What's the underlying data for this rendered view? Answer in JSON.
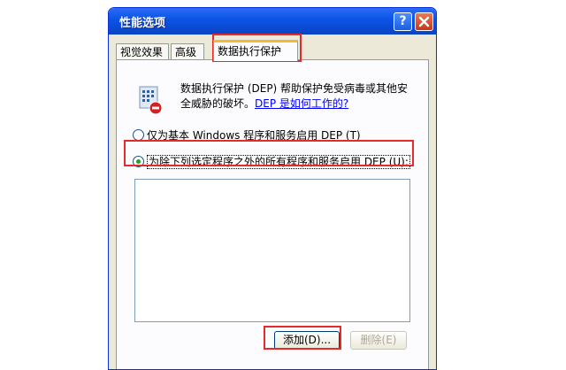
{
  "window": {
    "title": "性能选项",
    "help_label": "?"
  },
  "tabs": [
    {
      "label": "视觉效果"
    },
    {
      "label": "高级"
    },
    {
      "label": "数据执行保护"
    }
  ],
  "dep": {
    "description": "数据执行保护 (DEP) 帮助保护免受病毒或其他安全威胁的破坏。",
    "link": "DEP 是如何工作的?",
    "option1": "仅为基本 Windows 程序和服务启用 DEP (T)",
    "option2": "为除下列选定程序之外的所有程序和服务启用 DEP (U):"
  },
  "buttons": {
    "add": "添加(D)...",
    "remove": "删除(E)"
  },
  "colors": {
    "titlebar": "#0a4bd6",
    "highlight": "#e32b2b",
    "selected_tab_accent": "#f2b93b"
  },
  "icons": {
    "dep": "dep-shield-icon",
    "help": "help-icon",
    "close": "close-icon"
  }
}
